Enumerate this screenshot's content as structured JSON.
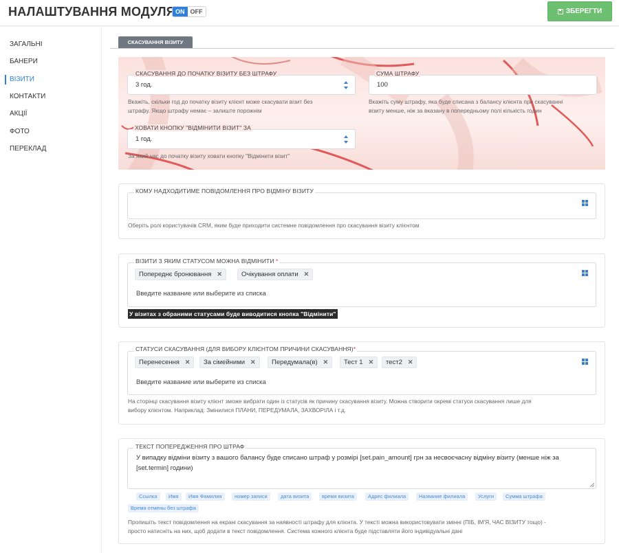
{
  "header": {
    "title": "НАЛАШТУВАННЯ МОДУЛЯ",
    "toggle_on": "ON",
    "toggle_off": "OFF",
    "save_label": "ЗБЕРЕГТИ"
  },
  "sidebar": {
    "items": [
      {
        "label": "ЗАГАЛЬНІ"
      },
      {
        "label": "БАНЕРИ"
      },
      {
        "label": "ВІЗИТИ"
      },
      {
        "label": "КОНТАКТИ"
      },
      {
        "label": "АКЦІЇ"
      },
      {
        "label": "ФОТО"
      },
      {
        "label": "ПЕРЕКЛАД"
      }
    ],
    "active_index": 2
  },
  "tab": {
    "label": "СКАСУВАННЯ ВІЗИТУ"
  },
  "cancel_before": {
    "legend": "СКАСУВАННЯ ДО ПОЧАТКУ ВІЗИТУ БЕЗ ШТРАФУ",
    "value": "3 год.",
    "hint_line1": "Вкажіть, скільки год до початку візиту клієнт може скасувати візит без",
    "hint_line2": "штрафу. Якщо штрафу немає – залиште порожнім"
  },
  "penalty": {
    "legend": "СУМА ШТРАФУ",
    "value": "100",
    "hint_line1": "Вкажіть суму штрафу, яка буде списана з балансу клієнта при скасуванні",
    "hint_line2": "візиту менше, ніж за вказану в попередньому полі кількість годин"
  },
  "hide_button": {
    "legend": "ХОВАТИ КНОПКУ \"ВІДМІНИТИ ВІЗИТ\" ЗА",
    "value": "1 год.",
    "hint": "За який час до початку візиту ховати кнопку \"Відмінити візит\""
  },
  "recipients": {
    "legend": "КОМУ НАДХОДИТИМЕ ПОВІДОМЛЕННЯ ПРО ВІДМІНУ ВІЗИТУ",
    "hint": "Оберіть ролі користувачів CRM, яким буде приходити системне повідомлення про скасування візиту клієнтом"
  },
  "statuses": {
    "legend": "ВІЗИТИ З ЯКИМ СТАТУСОМ МОЖНА ВІДМІНИТИ",
    "required": "*",
    "tags": [
      "Попереднє бронювання",
      "Очікування оплати"
    ],
    "placeholder": "Введите название или выберите из списка",
    "note": "У візитах з обраними статусами буде виводитися кнопка \"Відмінити\""
  },
  "reasons": {
    "legend": "СТАТУСИ СКАСУВАННЯ (ДЛЯ ВИБОРУ КЛІЄНТОМ ПРИЧИНИ СКАСУВАННЯ)",
    "required": "*",
    "tags": [
      "Перенесення",
      "За сімейними",
      "Передумала(в)",
      "Тест 1",
      "тест2"
    ],
    "placeholder": "Введите название или выберите из списка",
    "hint_line1": "На сторінці скасування візиту клієнт зможе вибрати один із статусів як причину скасування візиту. Можна створити окремі статуси скасування лише для",
    "hint_line2": "вибору клієнтом. Наприклад: Змінилися ПЛАНИ, ПЕРЕДУМАЛА, ЗАХВОРІЛА і т.д."
  },
  "warning_text": {
    "legend": "ТЕКСТ ПОПЕРЕДЖЕННЯ ПРО ШТРАФ",
    "value": "У випадку відміни візиту з вашого балансу буде списано штраф у розмірі [set.pain_amount] грн за несвоєчасну відміну візиту (менше ніж за [set.termin] години)",
    "chips": [
      "Ссылка",
      "Имя",
      "Имя Фамилия",
      "номер записи",
      "дата визита",
      "время визита",
      "Адрес филиала",
      "Название филиала",
      "Услуги",
      "Сумма штрафа",
      "Время отмены без штрафа"
    ],
    "hint_line1": "Пропишіть текст повідомлення на екрані скасування за наявності штрафу для клієнта. У тексті можна використовувати змінні (ПІБ, ІМ'Я, ЧАС ВІЗИТУ тощо) -",
    "hint_line2": "просто натисніть на них, щоб додати в текст повідомлення. Система кожного клієнта буде підставляти його індивідуальні дані"
  },
  "colors": {
    "accent": "#2f80d8",
    "save": "#6cc070",
    "promo_bg": "#fbe1dd",
    "promo_arc": "#e05a5a",
    "required": "#e03b3b"
  }
}
